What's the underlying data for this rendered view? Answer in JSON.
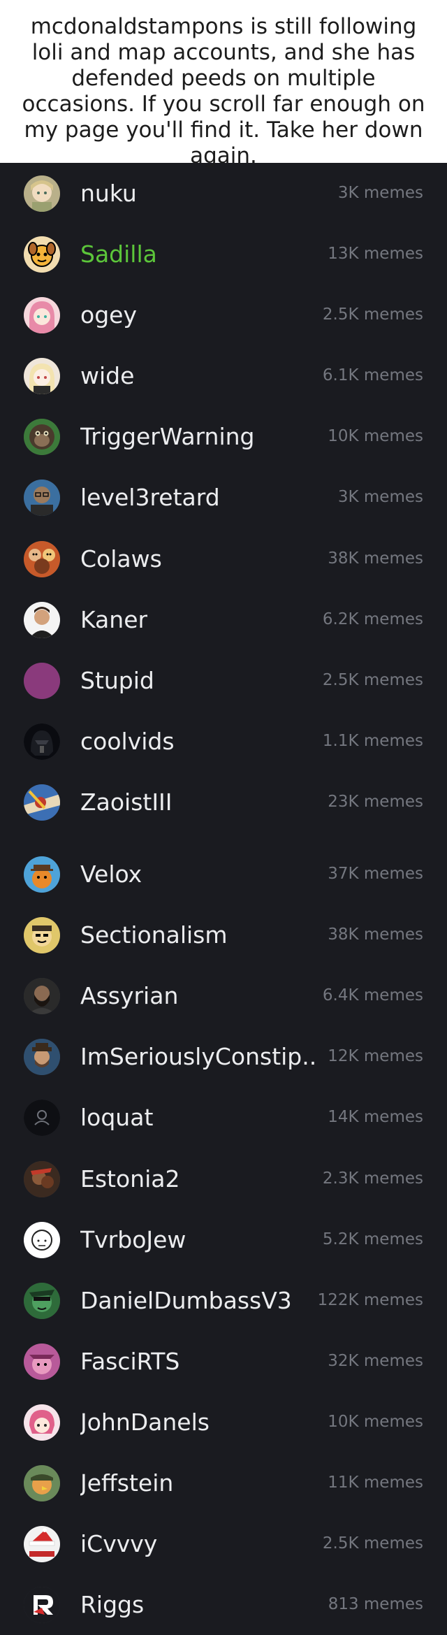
{
  "caption": "mcdonaldstampons is still following loli and map accounts, and she has defended peeds on multiple occasions. If you scroll far enough on my page you'll find it. Take her down again.",
  "unit_label": "memes",
  "accent_color": "#5cc63a",
  "users": [
    {
      "name": "nuku",
      "count": "3K memes",
      "avatar": "anime-girl-avatar"
    },
    {
      "name": "Sadilla",
      "count": "13K memes",
      "avatar": "cartoon-dog-avatar",
      "highlight": true
    },
    {
      "name": "ogey",
      "count": "2.5K memes",
      "avatar": "pink-hair-anime-avatar"
    },
    {
      "name": "wide",
      "count": "6.1K memes",
      "avatar": "blonde-anime-avatar"
    },
    {
      "name": "TriggerWarning",
      "count": "10K memes",
      "avatar": "monkey-avatar"
    },
    {
      "name": "level3retard",
      "count": "3K memes",
      "avatar": "man-with-glasses-avatar"
    },
    {
      "name": "Colaws",
      "count": "38K memes",
      "avatar": "cartoon-crowd-avatar"
    },
    {
      "name": "Kaner",
      "count": "6.2K memes",
      "avatar": "man-portrait-avatar"
    },
    {
      "name": "Stupid",
      "count": "2.5K memes",
      "avatar": "purple-circle-avatar"
    },
    {
      "name": "coolvids",
      "count": "1.1K memes",
      "avatar": "darth-vader-avatar"
    },
    {
      "name": "ZaoistIII",
      "count": "23K memes",
      "avatar": "illustration-avatar"
    },
    {
      "name": "Velox",
      "count": "37K memes",
      "avatar": "orange-bear-avatar",
      "gap_before": true
    },
    {
      "name": "Sectionalism",
      "count": "38K memes",
      "avatar": "cartoon-face-avatar"
    },
    {
      "name": "Assyrian",
      "count": "6.4K memes",
      "avatar": "bearded-man-avatar"
    },
    {
      "name": "ImSeriouslyConstip...",
      "count": "12K memes",
      "avatar": "man-with-hat-avatar"
    },
    {
      "name": "loquat",
      "count": "14K memes",
      "avatar": "default-user-avatar"
    },
    {
      "name": "Estonia2",
      "count": "2.3K memes",
      "avatar": "dark-photo-avatar"
    },
    {
      "name": "TvrboJew",
      "count": "5.2K memes",
      "avatar": "sketch-face-avatar"
    },
    {
      "name": "DanielDumbassV3",
      "count": "122K memes",
      "avatar": "green-character-avatar"
    },
    {
      "name": "FasciRTS",
      "count": "32K memes",
      "avatar": "pink-creature-avatar"
    },
    {
      "name": "JohnDanels",
      "count": "10K memes",
      "avatar": "anime-pink-avatar"
    },
    {
      "name": "Jeffstein",
      "count": "11K memes",
      "avatar": "cartoon-eagle-avatar"
    },
    {
      "name": "iCvvvy",
      "count": "2.5K memes",
      "avatar": "santa-hat-avatar"
    },
    {
      "name": "Riggs",
      "count": "813 memes",
      "avatar": "r-logo-avatar"
    }
  ]
}
